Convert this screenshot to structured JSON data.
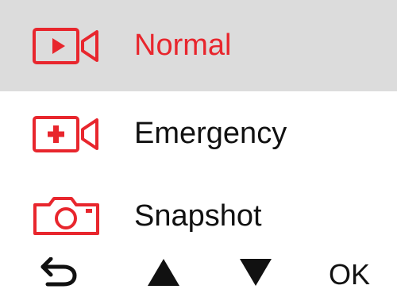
{
  "menu": {
    "items": [
      {
        "label": "Normal",
        "icon": "video-camera-play-icon",
        "selected": true
      },
      {
        "label": "Emergency",
        "icon": "video-camera-emergency-icon",
        "selected": false
      },
      {
        "label": "Snapshot",
        "icon": "photo-camera-icon",
        "selected": false
      }
    ]
  },
  "controls": {
    "back_icon": "back-arrow-icon",
    "up_icon": "triangle-up-icon",
    "down_icon": "triangle-down-icon",
    "ok_label": "OK"
  },
  "colors": {
    "accent": "#e8262d",
    "selected_background": "#dcdcdc",
    "text": "#111111"
  }
}
